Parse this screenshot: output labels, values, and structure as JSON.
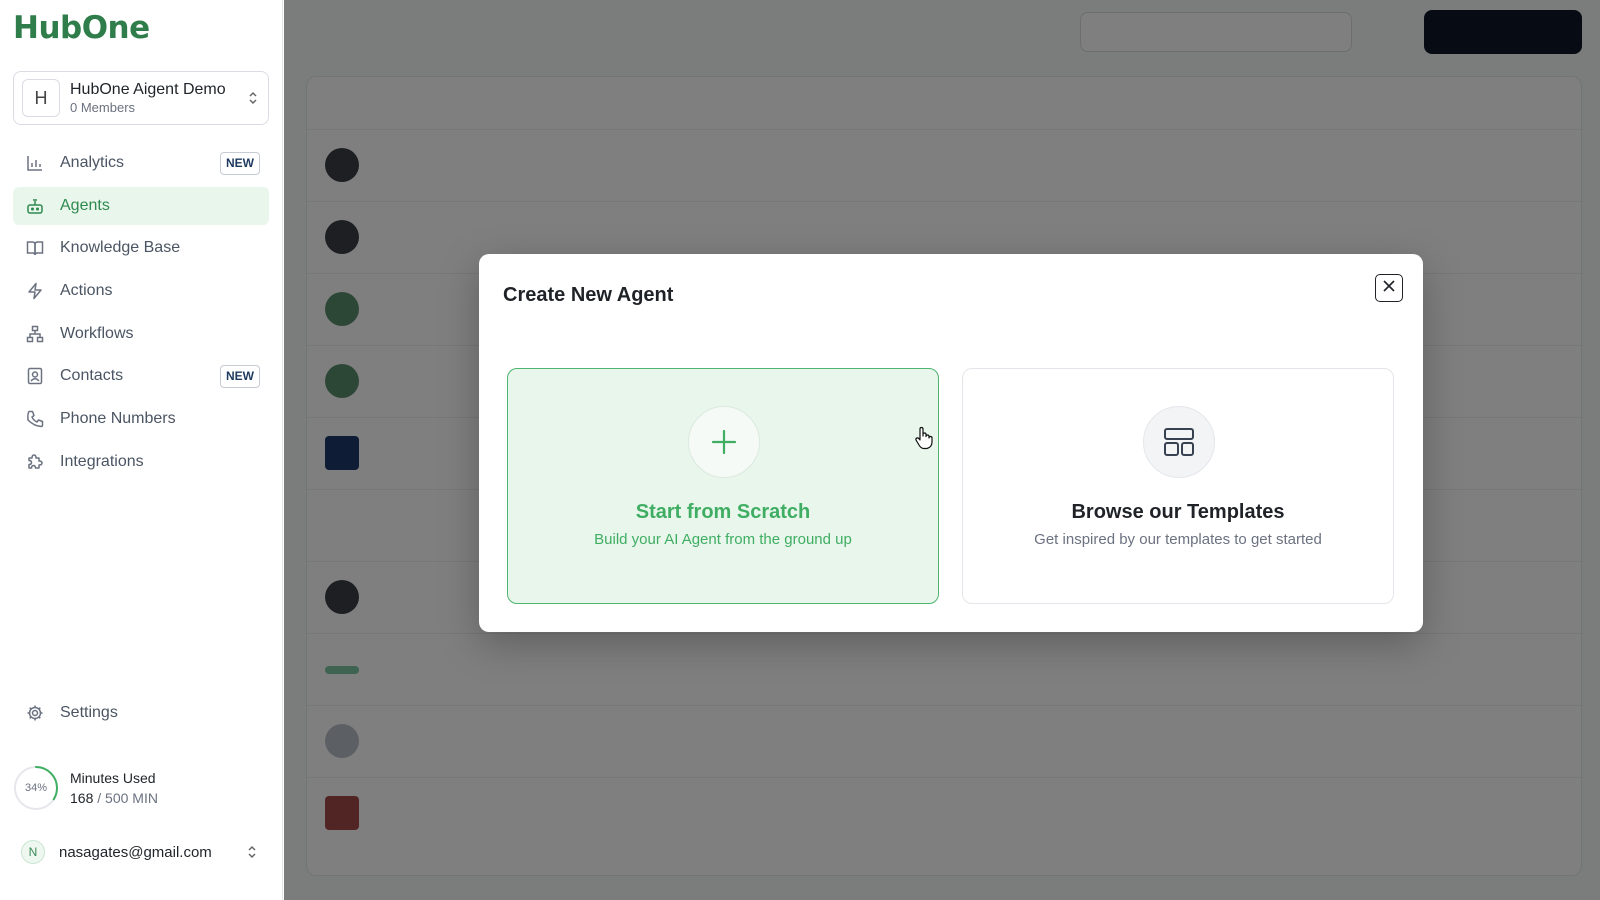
{
  "app": {
    "logo_text": "HubOne",
    "brand_color": "#2f7d4a",
    "accent_color": "#3fae63"
  },
  "workspace": {
    "avatar_letter": "H",
    "name": "HubOne Aigent Demo",
    "members": "0 Members"
  },
  "sidebar": {
    "items": [
      {
        "label": "Analytics",
        "icon": "bar-chart-icon",
        "badge": "NEW",
        "active": false
      },
      {
        "label": "Agents",
        "icon": "bot-icon",
        "badge": "",
        "active": true
      },
      {
        "label": "Knowledge Base",
        "icon": "book-icon",
        "badge": "",
        "active": false
      },
      {
        "label": "Actions",
        "icon": "bolt-icon",
        "badge": "",
        "active": false
      },
      {
        "label": "Workflows",
        "icon": "workflow-icon",
        "badge": "",
        "active": false
      },
      {
        "label": "Contacts",
        "icon": "contacts-icon",
        "badge": "NEW",
        "active": false
      },
      {
        "label": "Phone Numbers",
        "icon": "phone-icon",
        "badge": "",
        "active": false
      },
      {
        "label": "Integrations",
        "icon": "puzzle-icon",
        "badge": "",
        "active": false
      }
    ],
    "settings_label": "Settings"
  },
  "usage": {
    "percent_label": "34%",
    "percent": 0.34,
    "title": "Minutes Used",
    "used": "168",
    "total": "/ 500 MIN"
  },
  "user": {
    "avatar_letter": "N",
    "email": "nasagates@gmail.com"
  },
  "modal": {
    "title": "Create New Agent",
    "options": [
      {
        "title": "Start from Scratch",
        "subtitle": "Build your AI Agent from the ground up",
        "icon": "plus-icon"
      },
      {
        "title": "Browse our Templates",
        "subtitle": "Get inspired by our templates to get started",
        "icon": "template-icon"
      }
    ]
  }
}
